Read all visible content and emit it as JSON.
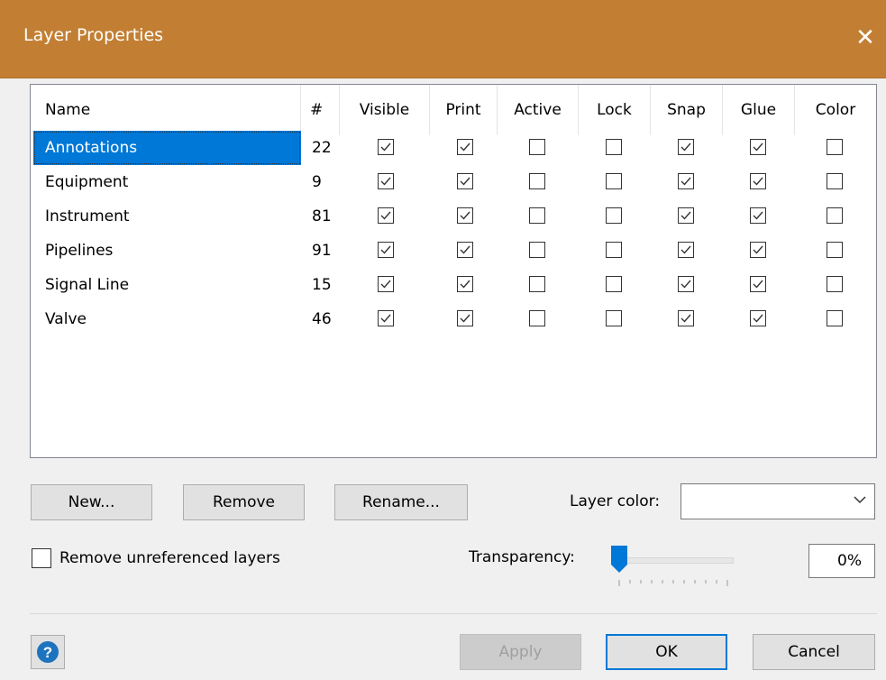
{
  "window": {
    "title": "Layer Properties",
    "close_glyph": "✕"
  },
  "columns": [
    "Name",
    "#",
    "Visible",
    "Print",
    "Active",
    "Lock",
    "Snap",
    "Glue",
    "Color"
  ],
  "layers": [
    {
      "name": "Annotations",
      "count": "22",
      "visible": true,
      "print": true,
      "active": false,
      "lock": false,
      "snap": true,
      "glue": true,
      "color": false,
      "selected": true
    },
    {
      "name": "Equipment",
      "count": "9",
      "visible": true,
      "print": true,
      "active": false,
      "lock": false,
      "snap": true,
      "glue": true,
      "color": false
    },
    {
      "name": "Instrument",
      "count": "81",
      "visible": true,
      "print": true,
      "active": false,
      "lock": false,
      "snap": true,
      "glue": true,
      "color": false
    },
    {
      "name": "Pipelines",
      "count": "91",
      "visible": true,
      "print": true,
      "active": false,
      "lock": false,
      "snap": true,
      "glue": true,
      "color": false
    },
    {
      "name": "Signal Line",
      "count": "15",
      "visible": true,
      "print": true,
      "active": false,
      "lock": false,
      "snap": true,
      "glue": true,
      "color": false
    },
    {
      "name": "Valve",
      "count": "46",
      "visible": true,
      "print": true,
      "active": false,
      "lock": false,
      "snap": true,
      "glue": true,
      "color": false
    }
  ],
  "buttons": {
    "new": "New...",
    "remove": "Remove",
    "rename": "Rename...",
    "apply": "Apply",
    "ok": "OK",
    "cancel": "Cancel"
  },
  "layer_color": {
    "label": "Layer color:",
    "value": ""
  },
  "remove_unreferenced": {
    "label": "Remove unreferenced layers",
    "checked": false
  },
  "transparency": {
    "label": "Transparency:",
    "value_text": "0%",
    "value": 0
  },
  "colors": {
    "title_bar": "#c27f33",
    "selection": "#0078d7",
    "help_icon": "#1e73be"
  }
}
